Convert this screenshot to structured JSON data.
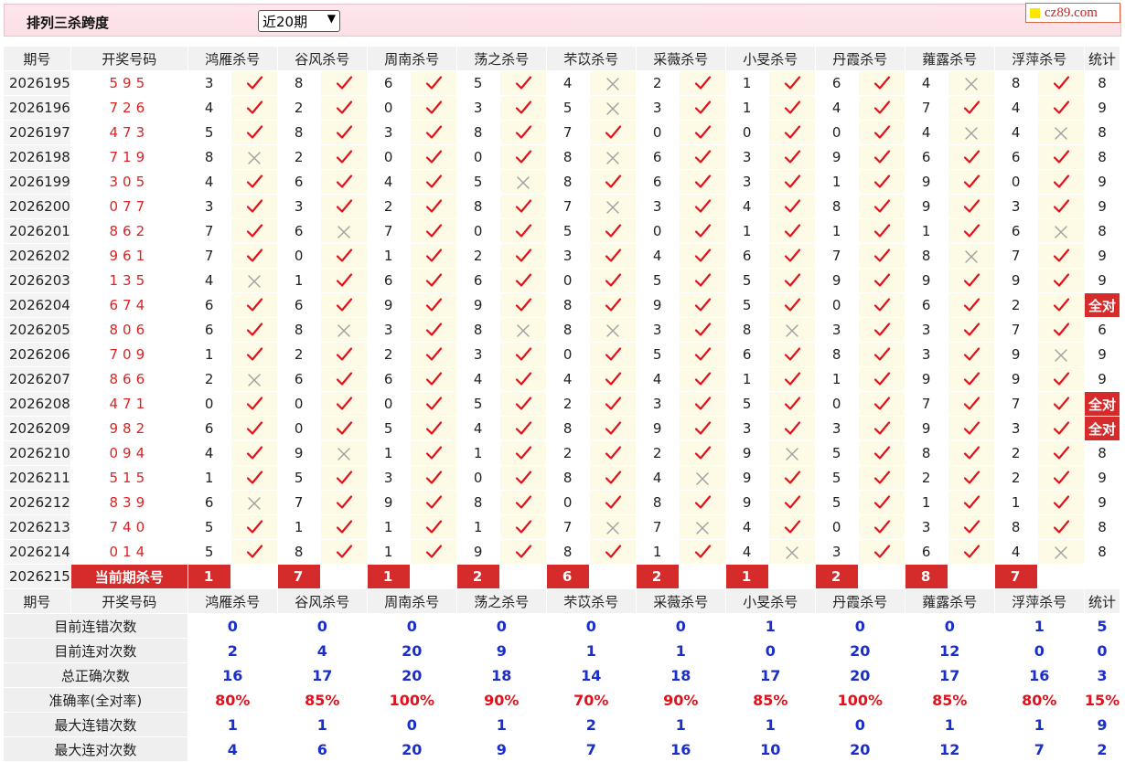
{
  "page": {
    "title": "排列三杀跨度",
    "period_select": "近20期",
    "site_badge": "cz89.com"
  },
  "columns": {
    "period": "期号",
    "number": "开奖号码",
    "experts": [
      "鸿雁杀号",
      "谷风杀号",
      "周南杀号",
      "荡之杀号",
      "芣苡杀号",
      "采薇杀号",
      "小旻杀号",
      "丹霞杀号",
      "蕹露杀号",
      "浮萍杀号"
    ],
    "stat": "统计"
  },
  "marks": {
    "hit": "hit-check-icon",
    "miss": "miss-cross-icon"
  },
  "colors": {
    "accent_red": "#d62b2b",
    "check_red": "#e0121c",
    "stat_blue": "#1a2fc9",
    "highlight_cell": "#fdfae6"
  },
  "rows": [
    {
      "period": "2026195",
      "number": "595",
      "cells": [
        [
          "3",
          1
        ],
        [
          "8",
          1
        ],
        [
          "6",
          1
        ],
        [
          "5",
          1
        ],
        [
          "4",
          0
        ],
        [
          "2",
          1
        ],
        [
          "1",
          1
        ],
        [
          "6",
          1
        ],
        [
          "4",
          0
        ],
        [
          "8",
          1
        ]
      ],
      "stat": "8"
    },
    {
      "period": "2026196",
      "number": "726",
      "cells": [
        [
          "4",
          1
        ],
        [
          "2",
          1
        ],
        [
          "0",
          1
        ],
        [
          "3",
          1
        ],
        [
          "5",
          0
        ],
        [
          "3",
          1
        ],
        [
          "1",
          1
        ],
        [
          "4",
          1
        ],
        [
          "7",
          1
        ],
        [
          "4",
          1
        ]
      ],
      "stat": "9"
    },
    {
      "period": "2026197",
      "number": "473",
      "cells": [
        [
          "5",
          1
        ],
        [
          "8",
          1
        ],
        [
          "3",
          1
        ],
        [
          "8",
          1
        ],
        [
          "7",
          1
        ],
        [
          "0",
          1
        ],
        [
          "0",
          1
        ],
        [
          "0",
          1
        ],
        [
          "4",
          0
        ],
        [
          "4",
          0
        ]
      ],
      "stat": "8"
    },
    {
      "period": "2026198",
      "number": "719",
      "cells": [
        [
          "8",
          0
        ],
        [
          "2",
          1
        ],
        [
          "0",
          1
        ],
        [
          "0",
          1
        ],
        [
          "8",
          0
        ],
        [
          "6",
          1
        ],
        [
          "3",
          1
        ],
        [
          "9",
          1
        ],
        [
          "6",
          1
        ],
        [
          "6",
          1
        ]
      ],
      "stat": "8"
    },
    {
      "period": "2026199",
      "number": "305",
      "cells": [
        [
          "4",
          1
        ],
        [
          "6",
          1
        ],
        [
          "4",
          1
        ],
        [
          "5",
          0
        ],
        [
          "8",
          1
        ],
        [
          "6",
          1
        ],
        [
          "3",
          1
        ],
        [
          "1",
          1
        ],
        [
          "9",
          1
        ],
        [
          "0",
          1
        ]
      ],
      "stat": "9"
    },
    {
      "period": "2026200",
      "number": "077",
      "cells": [
        [
          "3",
          1
        ],
        [
          "3",
          1
        ],
        [
          "2",
          1
        ],
        [
          "8",
          1
        ],
        [
          "7",
          0
        ],
        [
          "3",
          1
        ],
        [
          "4",
          1
        ],
        [
          "8",
          1
        ],
        [
          "9",
          1
        ],
        [
          "3",
          1
        ]
      ],
      "stat": "9"
    },
    {
      "period": "2026201",
      "number": "862",
      "cells": [
        [
          "7",
          1
        ],
        [
          "6",
          0
        ],
        [
          "7",
          1
        ],
        [
          "0",
          1
        ],
        [
          "5",
          1
        ],
        [
          "0",
          1
        ],
        [
          "1",
          1
        ],
        [
          "1",
          1
        ],
        [
          "1",
          1
        ],
        [
          "6",
          0
        ]
      ],
      "stat": "8"
    },
    {
      "period": "2026202",
      "number": "961",
      "cells": [
        [
          "7",
          1
        ],
        [
          "0",
          1
        ],
        [
          "1",
          1
        ],
        [
          "2",
          1
        ],
        [
          "3",
          1
        ],
        [
          "4",
          1
        ],
        [
          "6",
          1
        ],
        [
          "7",
          1
        ],
        [
          "8",
          0
        ],
        [
          "7",
          1
        ]
      ],
      "stat": "9"
    },
    {
      "period": "2026203",
      "number": "135",
      "cells": [
        [
          "4",
          0
        ],
        [
          "1",
          1
        ],
        [
          "6",
          1
        ],
        [
          "6",
          1
        ],
        [
          "0",
          1
        ],
        [
          "5",
          1
        ],
        [
          "5",
          1
        ],
        [
          "9",
          1
        ],
        [
          "9",
          1
        ],
        [
          "9",
          1
        ]
      ],
      "stat": "9"
    },
    {
      "period": "2026204",
      "number": "674",
      "cells": [
        [
          "6",
          1
        ],
        [
          "6",
          1
        ],
        [
          "9",
          1
        ],
        [
          "9",
          1
        ],
        [
          "8",
          1
        ],
        [
          "9",
          1
        ],
        [
          "5",
          1
        ],
        [
          "0",
          1
        ],
        [
          "6",
          1
        ],
        [
          "2",
          1
        ]
      ],
      "stat": "全对"
    },
    {
      "period": "2026205",
      "number": "806",
      "cells": [
        [
          "6",
          1
        ],
        [
          "8",
          0
        ],
        [
          "3",
          1
        ],
        [
          "8",
          0
        ],
        [
          "8",
          0
        ],
        [
          "3",
          1
        ],
        [
          "8",
          0
        ],
        [
          "3",
          1
        ],
        [
          "3",
          1
        ],
        [
          "7",
          1
        ]
      ],
      "stat": "6"
    },
    {
      "period": "2026206",
      "number": "709",
      "cells": [
        [
          "1",
          1
        ],
        [
          "2",
          1
        ],
        [
          "2",
          1
        ],
        [
          "3",
          1
        ],
        [
          "0",
          1
        ],
        [
          "5",
          1
        ],
        [
          "6",
          1
        ],
        [
          "8",
          1
        ],
        [
          "3",
          1
        ],
        [
          "9",
          0
        ]
      ],
      "stat": "9"
    },
    {
      "period": "2026207",
      "number": "866",
      "cells": [
        [
          "2",
          0
        ],
        [
          "6",
          1
        ],
        [
          "6",
          1
        ],
        [
          "4",
          1
        ],
        [
          "4",
          1
        ],
        [
          "4",
          1
        ],
        [
          "1",
          1
        ],
        [
          "1",
          1
        ],
        [
          "9",
          1
        ],
        [
          "9",
          1
        ]
      ],
      "stat": "9"
    },
    {
      "period": "2026208",
      "number": "471",
      "cells": [
        [
          "0",
          1
        ],
        [
          "0",
          1
        ],
        [
          "0",
          1
        ],
        [
          "5",
          1
        ],
        [
          "2",
          1
        ],
        [
          "3",
          1
        ],
        [
          "5",
          1
        ],
        [
          "0",
          1
        ],
        [
          "7",
          1
        ],
        [
          "7",
          1
        ]
      ],
      "stat": "全对"
    },
    {
      "period": "2026209",
      "number": "982",
      "cells": [
        [
          "6",
          1
        ],
        [
          "0",
          1
        ],
        [
          "5",
          1
        ],
        [
          "4",
          1
        ],
        [
          "8",
          1
        ],
        [
          "9",
          1
        ],
        [
          "3",
          1
        ],
        [
          "3",
          1
        ],
        [
          "9",
          1
        ],
        [
          "3",
          1
        ]
      ],
      "stat": "全对"
    },
    {
      "period": "2026210",
      "number": "094",
      "cells": [
        [
          "4",
          1
        ],
        [
          "9",
          0
        ],
        [
          "1",
          1
        ],
        [
          "1",
          1
        ],
        [
          "2",
          1
        ],
        [
          "2",
          1
        ],
        [
          "9",
          0
        ],
        [
          "5",
          1
        ],
        [
          "8",
          1
        ],
        [
          "2",
          1
        ]
      ],
      "stat": "8"
    },
    {
      "period": "2026211",
      "number": "515",
      "cells": [
        [
          "1",
          1
        ],
        [
          "5",
          1
        ],
        [
          "3",
          1
        ],
        [
          "0",
          1
        ],
        [
          "8",
          1
        ],
        [
          "4",
          0
        ],
        [
          "9",
          1
        ],
        [
          "5",
          1
        ],
        [
          "2",
          1
        ],
        [
          "2",
          1
        ]
      ],
      "stat": "9"
    },
    {
      "period": "2026212",
      "number": "839",
      "cells": [
        [
          "6",
          0
        ],
        [
          "7",
          1
        ],
        [
          "9",
          1
        ],
        [
          "8",
          1
        ],
        [
          "0",
          1
        ],
        [
          "8",
          1
        ],
        [
          "9",
          1
        ],
        [
          "5",
          1
        ],
        [
          "1",
          1
        ],
        [
          "1",
          1
        ]
      ],
      "stat": "9"
    },
    {
      "period": "2026213",
      "number": "740",
      "cells": [
        [
          "5",
          1
        ],
        [
          "1",
          1
        ],
        [
          "1",
          1
        ],
        [
          "1",
          1
        ],
        [
          "7",
          0
        ],
        [
          "7",
          0
        ],
        [
          "4",
          1
        ],
        [
          "0",
          1
        ],
        [
          "3",
          1
        ],
        [
          "8",
          1
        ]
      ],
      "stat": "8"
    },
    {
      "period": "2026214",
      "number": "014",
      "cells": [
        [
          "5",
          1
        ],
        [
          "8",
          1
        ],
        [
          "1",
          1
        ],
        [
          "9",
          1
        ],
        [
          "8",
          1
        ],
        [
          "1",
          1
        ],
        [
          "4",
          0
        ],
        [
          "3",
          1
        ],
        [
          "6",
          1
        ],
        [
          "4",
          0
        ]
      ],
      "stat": "8"
    }
  ],
  "current": {
    "period": "2026215",
    "label": "当前期杀号",
    "kills": [
      "1",
      "7",
      "1",
      "2",
      "6",
      "2",
      "1",
      "2",
      "8",
      "7"
    ]
  },
  "stats": [
    {
      "label": "目前连错次数",
      "values": [
        "0",
        "0",
        "0",
        "0",
        "0",
        "0",
        "1",
        "0",
        "0",
        "1"
      ],
      "stat": "5"
    },
    {
      "label": "目前连对次数",
      "values": [
        "2",
        "4",
        "20",
        "9",
        "1",
        "1",
        "0",
        "20",
        "12",
        "0"
      ],
      "stat": "0"
    },
    {
      "label": "总正确次数",
      "values": [
        "16",
        "17",
        "20",
        "18",
        "14",
        "18",
        "17",
        "20",
        "17",
        "16"
      ],
      "stat": "3"
    },
    {
      "label": "准确率(全对率)",
      "values": [
        "80%",
        "85%",
        "100%",
        "90%",
        "70%",
        "90%",
        "85%",
        "100%",
        "85%",
        "80%"
      ],
      "stat": "15%"
    },
    {
      "label": "最大连错次数",
      "values": [
        "1",
        "1",
        "0",
        "1",
        "2",
        "1",
        "1",
        "0",
        "1",
        "1"
      ],
      "stat": "9"
    },
    {
      "label": "最大连对次数",
      "values": [
        "4",
        "6",
        "20",
        "9",
        "7",
        "16",
        "10",
        "20",
        "12",
        "7"
      ],
      "stat": "2"
    }
  ]
}
